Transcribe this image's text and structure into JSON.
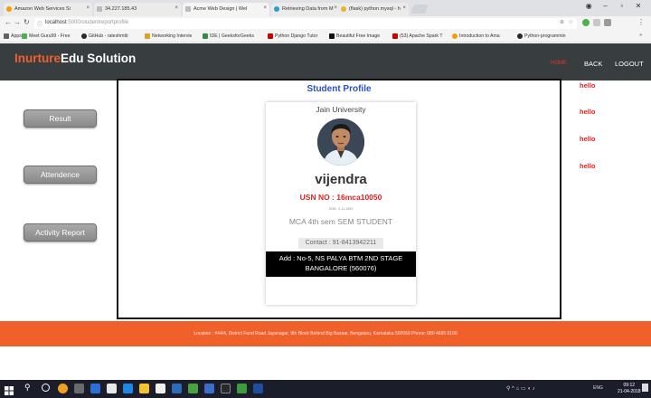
{
  "browser": {
    "tabs": [
      {
        "label": "Amazon Web Services Si",
        "color": "#ff9900"
      },
      {
        "label": "34.227.185.43",
        "color": "#999999"
      },
      {
        "label": "Acme Web Design | Wel",
        "color": "#999999"
      },
      {
        "label": "Retrieving Data from M",
        "color": "#28a0d0"
      },
      {
        "label": "(flask) python mysql - h",
        "color": "#f0b030"
      }
    ],
    "address": {
      "host": "localhost",
      "path": ":5000/studentreportprofile"
    },
    "bookmarks": [
      {
        "label": "Apps",
        "color": "#5f6368"
      },
      {
        "label": "Meet Guru99 - Free",
        "color": "#4caf50"
      },
      {
        "label": "GitHub - rateshmtti",
        "color": "#24292e"
      },
      {
        "label": "Networking Intervie",
        "color": "#e0a020"
      },
      {
        "label": "IDE | GeeksforGeeks",
        "color": "#2f8d46"
      },
      {
        "label": "Python Django Tutor",
        "color": "#cc0000"
      },
      {
        "label": "Beautiful Free Image",
        "color": "#111111"
      },
      {
        "label": "(53) Apache Spark T",
        "color": "#cc0000"
      },
      {
        "label": "Introduction to Ama",
        "color": "#f0a000"
      },
      {
        "label": "Python-programmin",
        "color": "#24292e"
      }
    ]
  },
  "site": {
    "brand_accent": "Inurture",
    "brand_rest": "Edu Solution",
    "nav": {
      "home": "HOME",
      "back": "BACK",
      "logout": "LOGOUT"
    }
  },
  "sidebar": {
    "buttons": [
      "Result",
      "Attendence",
      "Activity Report"
    ]
  },
  "profile": {
    "heading": "Student Profile",
    "university": "Jain University",
    "name": "vijendra",
    "usn": "USN NO : 16mca10050",
    "dob": "DOB : 2-11-1993",
    "course": "MCA 4th sem SEM STUDENT",
    "contact": "Contact : 91-8413942211",
    "address": "Add : No-5, NS PALYA BTM 2ND STAGE BANGALORE (560076)"
  },
  "right_messages": [
    "hello",
    "hello",
    "hello",
    "hello"
  ],
  "footer": {
    "text": "Location : #44/4, District Fund Road Jayanagar, 9th Block Behind Big Bazaar, Bengaluru, Karnataka 560069 Phone: 080 4665 0100"
  },
  "taskbar": {
    "time": "09:12",
    "date": "21-04-2018",
    "lang": "ENG"
  },
  "colors": {
    "accent": "#f0602a",
    "header": "#383d40",
    "alert_red": "#e02020",
    "title_blue": "#2b50c8"
  }
}
